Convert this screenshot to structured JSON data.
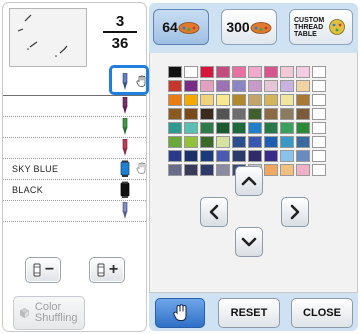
{
  "counter": {
    "current": "3",
    "total": "36"
  },
  "thread_list": [
    {
      "name": "",
      "spool_color": "#7f8fc0",
      "has_hand": true,
      "selected": true
    },
    {
      "name": "",
      "spool_color": "#7a2f6e",
      "has_hand": false
    },
    {
      "name": "",
      "spool_color": "#3f9a45",
      "has_hand": false
    },
    {
      "name": "",
      "spool_color": "#c43a55",
      "has_hand": false
    },
    {
      "name": "SKY BLUE",
      "spool_color": "#1f7fd0",
      "has_hand": true
    },
    {
      "name": "BLACK",
      "spool_color": "#111111",
      "has_hand": false
    },
    {
      "name": "",
      "spool_color": "#7f8fc0",
      "has_hand": false
    },
    {
      "name": "",
      "spool_color": "",
      "has_hand": false
    }
  ],
  "buttons": {
    "decrease_label": "−",
    "increase_label": "+",
    "color_shuffling": "Color Shuffling",
    "reset": "RESET",
    "close": "CLOSE"
  },
  "tabs": [
    {
      "label": "64",
      "active": true
    },
    {
      "label": "300",
      "active": false
    },
    {
      "label": "CUSTOM THREAD TABLE",
      "active": false
    }
  ],
  "palette": [
    "#111111",
    "#ffffff",
    "#d7163b",
    "#c64b7e",
    "#ea6fa0",
    "#f2a8c8",
    "#d9558e",
    "#f3c8d8",
    "#f4cde2",
    "#ffffff",
    "#c7362a",
    "#7a2b88",
    "#e3a1c2",
    "#9c71b6",
    "#8b85c6",
    "#c79ac9",
    "#e6c5d9",
    "#c9b2df",
    "#f0d3a1",
    "#ffffff",
    "#ea7b10",
    "#f2a900",
    "#efd27a",
    "#f8e98f",
    "#b0892a",
    "#c2a36b",
    "#d2b45a",
    "#f0e5a0",
    "#a67834",
    "#ffffff",
    "#8b5a1e",
    "#7a4a1a",
    "#3b2a20",
    "#545454",
    "#6d6d6d",
    "#3f5f2e",
    "#8b6a44",
    "#8c7d60",
    "#7b5b3a",
    "#ffffff",
    "#2f9a8e",
    "#57c0b2",
    "#2f7a4a",
    "#1a5a2e",
    "#1b6b3a",
    "#1f7fc7",
    "#267a4a",
    "#3aa05a",
    "#2a8a3a",
    "#ffffff",
    "#6aa83a",
    "#93c23a",
    "#3a6a2a",
    "#d6e2a0",
    "#2a4f8f",
    "#3a57b2",
    "#1f5fb2",
    "#3a9ac7",
    "#3a6aa0",
    "#ffffff",
    "#2a3a8a",
    "#1b2f6a",
    "#1a3a7a",
    "#4a5ab2",
    "#2a3a6a",
    "#2f2a6a",
    "#3a2a8a",
    "#8ac2ea",
    "#6a8ac2",
    "#ffffff",
    "#6a6a8a",
    "#3a3a5a",
    "#2f3a6a",
    "#8a8aa2",
    "#3a4a7a",
    "#c7c7d7",
    "#f0a860",
    "#f0c080",
    "#f0b0c8",
    "#ffffff"
  ],
  "icons": {
    "hand": "hand-pointer-icon",
    "spool": "thread-spool-icon",
    "arrow_up": "arrow-up-icon",
    "arrow_down": "arrow-down-icon",
    "arrow_left": "arrow-left-icon",
    "arrow_right": "arrow-right-icon"
  },
  "colors": {
    "accent": "#1f7ee0",
    "tab_bar": "#cfe2f4",
    "panel_bg": "#f2f2f2"
  }
}
